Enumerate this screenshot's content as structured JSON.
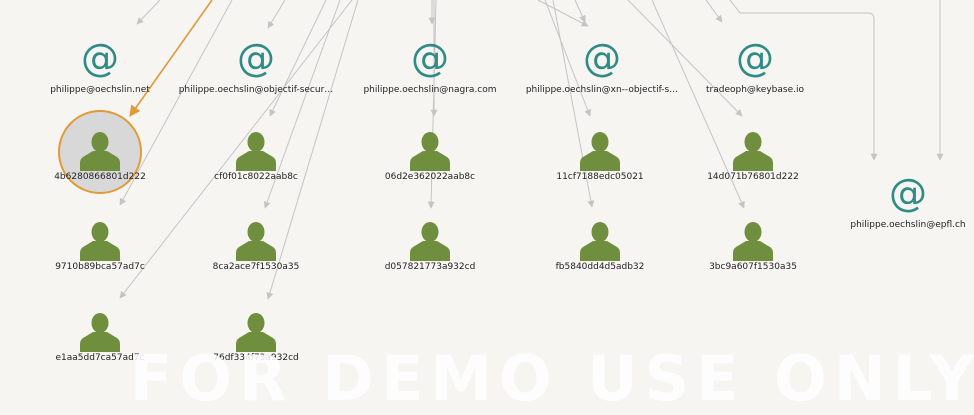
{
  "emails": [
    {
      "id": "e1",
      "label": "philippe@oechslin.net"
    },
    {
      "id": "e2",
      "label": "philippe.oechslin@objectif-secur…"
    },
    {
      "id": "e3",
      "label": "philippe.oechslin@nagra.com"
    },
    {
      "id": "e4",
      "label": "philippe.oechslin@xn--objectif-s…"
    },
    {
      "id": "e5",
      "label": "tradeoph@keybase.io"
    },
    {
      "id": "e6",
      "label": "philippe.oechslin@epfl.ch"
    }
  ],
  "keys": [
    {
      "id": "k1",
      "label": "4b6280866801d222",
      "selected": true
    },
    {
      "id": "k2",
      "label": "9710b89bca57ad7c"
    },
    {
      "id": "k3",
      "label": "e1aa5dd7ca57ad7c"
    },
    {
      "id": "k4",
      "label": "cf0f01c8022aab8c"
    },
    {
      "id": "k5",
      "label": "8ca2ace7f1530a35"
    },
    {
      "id": "k6",
      "label": "76df334f73a932cd"
    },
    {
      "id": "k7",
      "label": "06d2e362022aab8c"
    },
    {
      "id": "k8",
      "label": "d057821773a932cd"
    },
    {
      "id": "k9",
      "label": "11cf7188edc05021"
    },
    {
      "id": "k10",
      "label": "fb5840dd4d5adb32"
    },
    {
      "id": "k11",
      "label": "14d071b76801d222"
    },
    {
      "id": "k12",
      "label": "3bc9a607f1530a35"
    }
  ],
  "icons": {
    "email": "at-sign-icon",
    "key": "person-icon"
  },
  "colors": {
    "email": "#2e8b86",
    "person": "#6f8f3e",
    "highlight": "#e09a3a",
    "edge": "#c4c4c4"
  },
  "watermark": "FOR DEMO USE ONLY"
}
